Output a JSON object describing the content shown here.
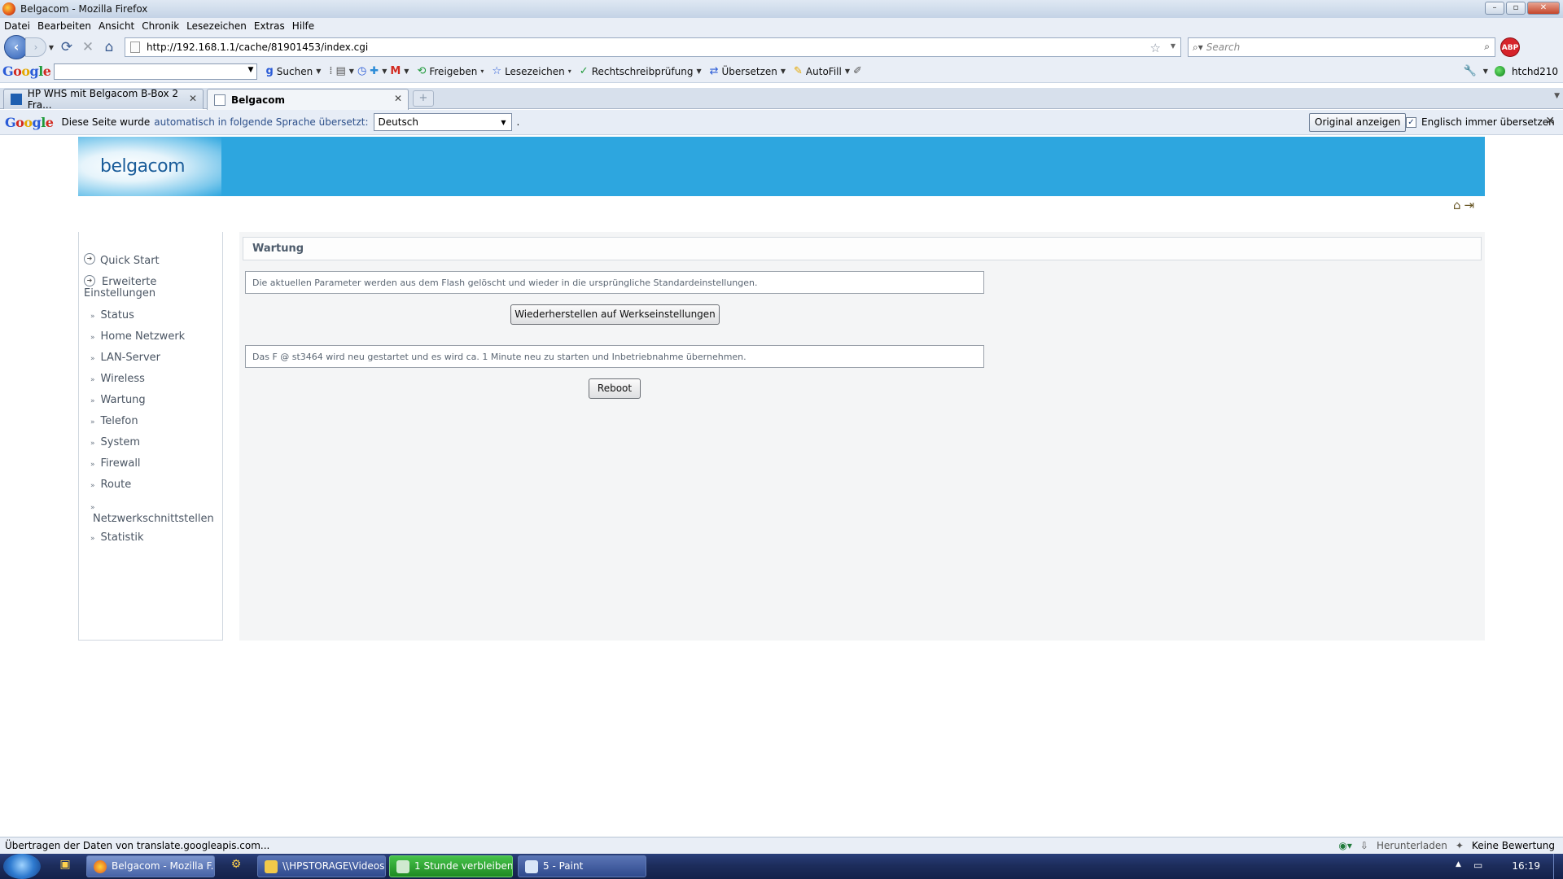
{
  "window": {
    "title": "Belgacom - Mozilla Firefox"
  },
  "menubar": [
    "Datei",
    "Bearbeiten",
    "Ansicht",
    "Chronik",
    "Lesezeichen",
    "Extras",
    "Hilfe"
  ],
  "navbar": {
    "url": "http://192.168.1.1/cache/81901453/index.cgi",
    "search_placeholder": "Search",
    "abp_label": "ABP"
  },
  "google_toolbar": {
    "logo": [
      "G",
      "o",
      "o",
      "g",
      "l",
      "e"
    ],
    "search": "Suchen",
    "share": "Freigeben",
    "bookmarks": "Lesezeichen",
    "spellcheck": "Rechtschreibprüfung",
    "translate": "Übersetzen",
    "autofill": "AutoFill",
    "user": "htchd210"
  },
  "tabs": [
    {
      "label": "HP WHS mit Belgacom B-Box 2 Fra...",
      "active": false
    },
    {
      "label": "Belgacom",
      "active": true
    }
  ],
  "translate_bar": {
    "text1": "Diese Seite wurde",
    "text2": "automatisch in folgende Sprache übersetzt:",
    "language": "Deutsch",
    "period": ".",
    "original_button": "Original anzeigen",
    "always_label": "Englisch immer übersetzen"
  },
  "page": {
    "logo": "belgacom",
    "sidebar": {
      "main": [
        "Quick Start",
        "Erweiterte Einstellungen"
      ],
      "sub": [
        "Status",
        "Home Netzwerk",
        "LAN-Server",
        "Wireless",
        "Wartung",
        "Telefon",
        "System",
        "Firewall",
        "Route",
        "Netzwerkschnittstellen",
        "Statistik"
      ]
    },
    "section_title": "Wartung",
    "reset_message": "Die aktuellen Parameter werden aus dem Flash gelöscht und wieder in die ursprüngliche Standardeinstellungen.",
    "reset_button": "Wiederherstellen auf Werkseinstellungen",
    "reboot_message": "Das F @ st3464 wird neu gestartet und es wird ca. 1 Minute neu zu starten und Inbetriebnahme übernehmen.",
    "reboot_button": "Reboot"
  },
  "statusbar": {
    "text": "Übertragen der Daten von translate.googleapis.com...",
    "download": "Herunterladen",
    "rating": "Keine Bewertung"
  },
  "taskbar": {
    "items": [
      {
        "label": "Belgacom - Mozilla F...",
        "active": true
      },
      {
        "label": "\\\\HPSTORAGE\\Videos",
        "active": false
      },
      {
        "label": "1 Stunde verbleibend",
        "active": false
      },
      {
        "label": "5 - Paint",
        "active": false
      }
    ],
    "clock": "16:19"
  },
  "colors": {
    "banner": "#2da6df",
    "content_bg": "#f4f5f6",
    "sidebar_text": "#4a5563"
  }
}
